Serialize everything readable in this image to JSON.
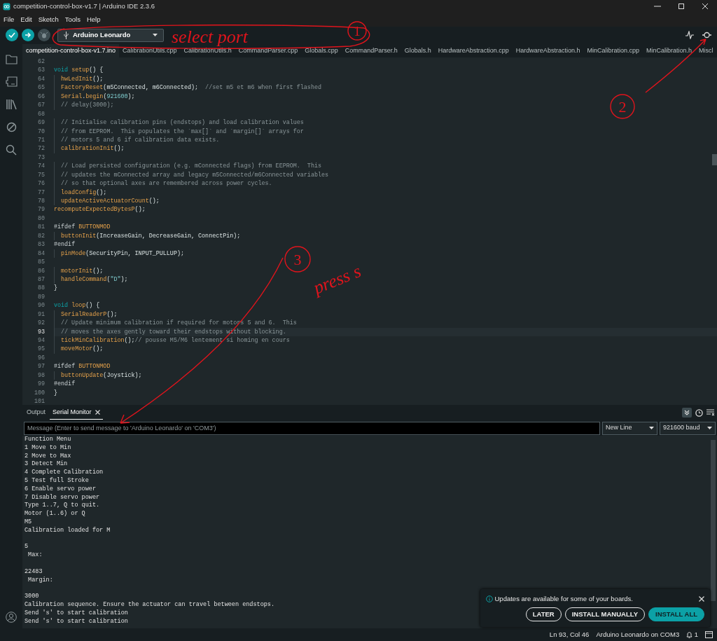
{
  "window": {
    "title": "competition-control-box-v1.7 | Arduino IDE 2.3.6"
  },
  "menu": [
    "File",
    "Edit",
    "Sketch",
    "Tools",
    "Help"
  ],
  "toolbar": {
    "board": "Arduino Leonardo",
    "debug_disabled": true
  },
  "file_tabs": [
    {
      "label": "competition-control-box-v1.7.ino",
      "selected": true
    },
    {
      "label": "CalibrationUtils.cpp",
      "selected": false
    },
    {
      "label": "CalibrationUtils.h",
      "selected": false
    },
    {
      "label": "CommandParser.cpp",
      "selected": false
    },
    {
      "label": "Globals.cpp",
      "selected": false
    },
    {
      "label": "CommandParser.h",
      "selected": false
    },
    {
      "label": "Globals.h",
      "selected": false
    },
    {
      "label": "HardwareAbstraction.cpp",
      "selected": false
    },
    {
      "label": "HardwareAbstraction.h",
      "selected": false
    },
    {
      "label": "MinCalibration.cpp",
      "selected": false
    },
    {
      "label": "MinCalibration.h",
      "selected": false
    },
    {
      "label": "Miscl",
      "selected": false
    }
  ],
  "editor": {
    "lines": [
      {
        "number": "62",
        "current": false
      },
      {
        "number": "63",
        "current": false,
        "indented": false,
        "tokens": [
          {
            "kind": "kw",
            "text": "void "
          },
          {
            "kind": "fn",
            "text": "setup"
          },
          {
            "kind": "plain",
            "text": "() {"
          }
        ]
      },
      {
        "number": "64",
        "current": false,
        "indented": true,
        "tokens": [
          {
            "kind": "fn",
            "text": "hwLedInit"
          },
          {
            "kind": "plain",
            "text": "();"
          }
        ]
      },
      {
        "number": "65",
        "current": false,
        "indented": true,
        "tokens": [
          {
            "kind": "fn",
            "text": "FactoryReset"
          },
          {
            "kind": "plain",
            "text": "(m5Connected, m6Connected);  "
          },
          {
            "kind": "cmt",
            "text": "//set m5 et m6 when first flashed"
          }
        ]
      },
      {
        "number": "66",
        "current": false,
        "indented": true,
        "tokens": [
          {
            "kind": "fn",
            "text": "Serial"
          },
          {
            "kind": "plain",
            "text": "."
          },
          {
            "kind": "fn",
            "text": "begin"
          },
          {
            "kind": "plain",
            "text": "("
          },
          {
            "kind": "num",
            "text": "921600"
          },
          {
            "kind": "plain",
            "text": ");"
          }
        ]
      },
      {
        "number": "67",
        "current": false,
        "indented": true,
        "tokens": [
          {
            "kind": "cmt",
            "text": "// delay(3000);"
          }
        ]
      },
      {
        "number": "68",
        "current": false
      },
      {
        "number": "69",
        "current": false,
        "indented": true,
        "tokens": [
          {
            "kind": "cmt",
            "text": "// Initialise calibration pins (endstops) and load calibration values"
          }
        ]
      },
      {
        "number": "70",
        "current": false,
        "indented": true,
        "tokens": [
          {
            "kind": "cmt",
            "text": "// from EEPROM.  This populates the `max[]` and `margin[]` arrays for"
          }
        ]
      },
      {
        "number": "71",
        "current": false,
        "indented": true,
        "tokens": [
          {
            "kind": "cmt",
            "text": "// motors 5 and 6 if calibration data exists."
          }
        ]
      },
      {
        "number": "72",
        "current": false,
        "indented": true,
        "tokens": [
          {
            "kind": "fn",
            "text": "calibrationInit"
          },
          {
            "kind": "plain",
            "text": "();"
          }
        ]
      },
      {
        "number": "73",
        "current": false
      },
      {
        "number": "74",
        "current": false,
        "indented": true,
        "tokens": [
          {
            "kind": "cmt",
            "text": "// Load persisted configuration (e.g. mConnected flags) from EEPROM.  This"
          }
        ]
      },
      {
        "number": "75",
        "current": false,
        "indented": true,
        "tokens": [
          {
            "kind": "cmt",
            "text": "// updates the mConnected array and legacy m5Connected/m6Connected variables"
          }
        ]
      },
      {
        "number": "76",
        "current": false,
        "indented": true,
        "tokens": [
          {
            "kind": "cmt",
            "text": "// so that optional axes are remembered across power cycles."
          }
        ]
      },
      {
        "number": "77",
        "current": false,
        "indented": true,
        "tokens": [
          {
            "kind": "fn",
            "text": "loadConfig"
          },
          {
            "kind": "plain",
            "text": "();"
          }
        ]
      },
      {
        "number": "78",
        "current": false,
        "indented": true,
        "tokens": [
          {
            "kind": "fn",
            "text": "updateActiveActuatorCount"
          },
          {
            "kind": "plain",
            "text": "();"
          }
        ]
      },
      {
        "number": "79",
        "current": false,
        "indented": false,
        "tokens": [
          {
            "kind": "fn",
            "text": "recomputeExpectedBytesP"
          },
          {
            "kind": "plain",
            "text": "();"
          }
        ]
      },
      {
        "number": "80",
        "current": false
      },
      {
        "number": "81",
        "current": false,
        "indented": false,
        "tokens": [
          {
            "kind": "pp",
            "text": "#ifdef "
          },
          {
            "kind": "fn",
            "text": "BUTTONMOD"
          }
        ]
      },
      {
        "number": "82",
        "current": false,
        "indented": true,
        "tokens": [
          {
            "kind": "fn",
            "text": "buttonInit"
          },
          {
            "kind": "plain",
            "text": "(IncreaseGain, DecreaseGain, ConnectPin);"
          }
        ]
      },
      {
        "number": "83",
        "current": false,
        "indented": false,
        "tokens": [
          {
            "kind": "pp",
            "text": "#endif"
          }
        ]
      },
      {
        "number": "84",
        "current": false,
        "indented": true,
        "tokens": [
          {
            "kind": "fn",
            "text": "pinMode"
          },
          {
            "kind": "plain",
            "text": "(SecurityPin, INPUT_PULLUP);"
          }
        ]
      },
      {
        "number": "85",
        "current": false
      },
      {
        "number": "86",
        "current": false,
        "indented": true,
        "tokens": [
          {
            "kind": "fn",
            "text": "motorInit"
          },
          {
            "kind": "plain",
            "text": "();"
          }
        ]
      },
      {
        "number": "87",
        "current": false,
        "indented": true,
        "tokens": [
          {
            "kind": "fn",
            "text": "handleCommand"
          },
          {
            "kind": "plain",
            "text": "("
          },
          {
            "kind": "str",
            "text": "\"D\""
          },
          {
            "kind": "plain",
            "text": ");"
          }
        ]
      },
      {
        "number": "88",
        "current": false,
        "indented": false,
        "tokens": [
          {
            "kind": "plain",
            "text": "}"
          }
        ]
      },
      {
        "number": "89",
        "current": false
      },
      {
        "number": "90",
        "current": false,
        "indented": false,
        "tokens": [
          {
            "kind": "kw",
            "text": "void "
          },
          {
            "kind": "fn",
            "text": "loop"
          },
          {
            "kind": "plain",
            "text": "() {"
          }
        ]
      },
      {
        "number": "91",
        "current": false,
        "indented": true,
        "tokens": [
          {
            "kind": "fn",
            "text": "SerialReaderP"
          },
          {
            "kind": "plain",
            "text": "();"
          }
        ]
      },
      {
        "number": "92",
        "current": false,
        "indented": true,
        "tokens": [
          {
            "kind": "cmt",
            "text": "// Update minimum calibration if required for motors 5 and 6.  This"
          }
        ]
      },
      {
        "number": "93",
        "current": true,
        "indented": true,
        "tokens": [
          {
            "kind": "cmt",
            "text": "// moves the axes gently toward their endstops without blocking."
          }
        ]
      },
      {
        "number": "94",
        "current": false,
        "indented": true,
        "tokens": [
          {
            "kind": "fn",
            "text": "tickMinCalibration"
          },
          {
            "kind": "plain",
            "text": "();"
          },
          {
            "kind": "cmt",
            "text": "// pousse M5/M6 lentement si homing en cours"
          }
        ]
      },
      {
        "number": "95",
        "current": false,
        "indented": true,
        "tokens": [
          {
            "kind": "fn",
            "text": "moveMotor"
          },
          {
            "kind": "plain",
            "text": "();"
          }
        ]
      },
      {
        "number": "96",
        "current": false
      },
      {
        "number": "97",
        "current": false,
        "indented": false,
        "tokens": [
          {
            "kind": "pp",
            "text": "#ifdef "
          },
          {
            "kind": "fn",
            "text": "BUTTONMOD"
          }
        ]
      },
      {
        "number": "98",
        "current": false,
        "indented": true,
        "tokens": [
          {
            "kind": "fn",
            "text": "buttonUpdate"
          },
          {
            "kind": "plain",
            "text": "(Joystick);"
          }
        ]
      },
      {
        "number": "99",
        "current": false,
        "indented": false,
        "tokens": [
          {
            "kind": "pp",
            "text": "#endif"
          }
        ]
      },
      {
        "number": "100",
        "current": false,
        "indented": false,
        "tokens": [
          {
            "kind": "plain",
            "text": "}"
          }
        ]
      },
      {
        "number": "101",
        "current": false
      }
    ]
  },
  "panel": {
    "tabs": [
      {
        "label": "Output",
        "selected": false,
        "closable": false
      },
      {
        "label": "Serial Monitor",
        "selected": true,
        "closable": true
      }
    ],
    "autoscroll": true,
    "message_placeholder": "Message (Enter to send message to 'Arduino Leonardo' on 'COM3')",
    "line_ending": "New Line",
    "baud_rate": "921600 baud",
    "output": [
      {
        "text": "Function Menu",
        "blank_after": false
      },
      {
        "text": "1 Move to Min",
        "blank_after": false
      },
      {
        "text": "2 Move to Max",
        "blank_after": false
      },
      {
        "text": "3 Detect Min",
        "blank_after": false
      },
      {
        "text": "4 Complete Calibration",
        "blank_after": false
      },
      {
        "text": "5 Test full Stroke",
        "blank_after": false
      },
      {
        "text": "6 Enable servo power",
        "blank_after": false
      },
      {
        "text": "7 Disable servo power",
        "blank_after": false
      },
      {
        "text": "Type 1..7, Q to quit.",
        "blank_after": false
      },
      {
        "text": "Motor (1..6) or Q",
        "blank_after": false
      },
      {
        "text": "M5",
        "blank_after": false
      },
      {
        "text": "Calibration loaded for M",
        "blank_after": true
      },
      {
        "text": "5",
        "blank_after": false
      },
      {
        "text": " Max:",
        "blank_after": true
      },
      {
        "text": "22483",
        "blank_after": false
      },
      {
        "text": " Margin:",
        "blank_after": true
      },
      {
        "text": "3000",
        "blank_after": false
      },
      {
        "text": "Calibration sequence. Ensure the actuator can travel between endstops.",
        "blank_after": false
      },
      {
        "text": "Send 's' to start calibration",
        "blank_after": false
      },
      {
        "text": "Send 's' to start calibration",
        "blank_after": false
      }
    ]
  },
  "notification": {
    "message": "Updates are available for some of your boards.",
    "buttons": [
      {
        "label": "LATER",
        "kind": "outline"
      },
      {
        "label": "INSTALL MANUALLY",
        "kind": "outline"
      },
      {
        "label": "INSTALL ALL",
        "kind": "primary"
      }
    ]
  },
  "status_bar": {
    "position": "Ln 93, Col 46",
    "board": "Arduino Leonardo on COM3",
    "notifications": "1"
  },
  "annotations": {
    "note_1": "select port",
    "marker_1": "1",
    "marker_2": "2",
    "marker_3": "3",
    "note_2": "press s"
  }
}
